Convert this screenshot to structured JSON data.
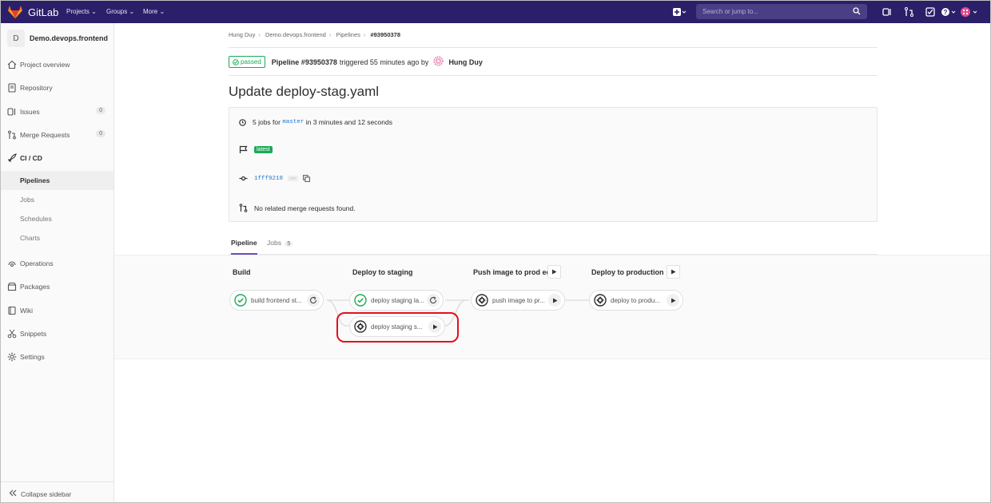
{
  "navbar": {
    "brand": "GitLab",
    "menu": [
      "Projects",
      "Groups",
      "More"
    ],
    "search_placeholder": "Search or jump to...",
    "icons": [
      "plus-icon",
      "search-icon",
      "issues-icon",
      "merge-request-icon",
      "todo-icon",
      "help-icon",
      "user-avatar-icon"
    ]
  },
  "sidebar": {
    "project_initial": "D",
    "project_name": "Demo.devops.frontend",
    "items": [
      {
        "label": "Project overview",
        "icon": "home-icon"
      },
      {
        "label": "Repository",
        "icon": "book-icon"
      },
      {
        "label": "Issues",
        "icon": "issues-icon",
        "count": "0"
      },
      {
        "label": "Merge Requests",
        "icon": "merge-request-icon",
        "count": "0"
      },
      {
        "label": "CI / CD",
        "icon": "rocket-icon"
      },
      {
        "label": "Operations",
        "icon": "cloud-gear-icon"
      },
      {
        "label": "Packages",
        "icon": "package-icon"
      },
      {
        "label": "Wiki",
        "icon": "book-open-icon"
      },
      {
        "label": "Snippets",
        "icon": "scissors-icon"
      },
      {
        "label": "Settings",
        "icon": "gear-icon"
      }
    ],
    "ci_sub": [
      "Pipelines",
      "Jobs",
      "Schedules",
      "Charts"
    ],
    "collapse_label": "Collapse sidebar"
  },
  "breadcrumb": [
    "Hung Duy",
    "Demo.devops.frontend",
    "Pipelines",
    "#93950378"
  ],
  "status": {
    "badge": "passed",
    "pipeline_label": "Pipeline #93950378",
    "triggered_text": "triggered 55 minutes ago by",
    "user": "Hung Duy"
  },
  "title": "Update deploy-stag.yaml",
  "info": {
    "jobs_prefix": "5 jobs for",
    "branch": "master",
    "duration": "in 3 minutes and 12 seconds",
    "tag": "latest",
    "commit": "1fff9218",
    "dots": "···",
    "mr_text": "No related merge requests found."
  },
  "tabs": [
    {
      "label": "Pipeline",
      "active": true
    },
    {
      "label": "Jobs",
      "count": "5",
      "active": false
    }
  ],
  "stages": [
    {
      "title": "Build",
      "has_play": false
    },
    {
      "title": "Deploy to staging",
      "has_play": false
    },
    {
      "title": "Push image to prod ec",
      "has_play": true
    },
    {
      "title": "Deploy to production",
      "has_play": true
    }
  ],
  "jobs": [
    {
      "name": "build frontend st...",
      "status": "success",
      "action": "retry"
    },
    {
      "name": "deploy staging la...",
      "status": "success",
      "action": "retry"
    },
    {
      "name": "deploy staging s...",
      "status": "manual",
      "action": "play"
    },
    {
      "name": "push image to pr...",
      "status": "manual",
      "action": "play"
    },
    {
      "name": "deploy to produ...",
      "status": "manual",
      "action": "play"
    }
  ],
  "colors": {
    "navbar": "#2b1f69",
    "success": "#1aaa55",
    "highlight": "#e3101c",
    "link": "#1f78d1"
  }
}
